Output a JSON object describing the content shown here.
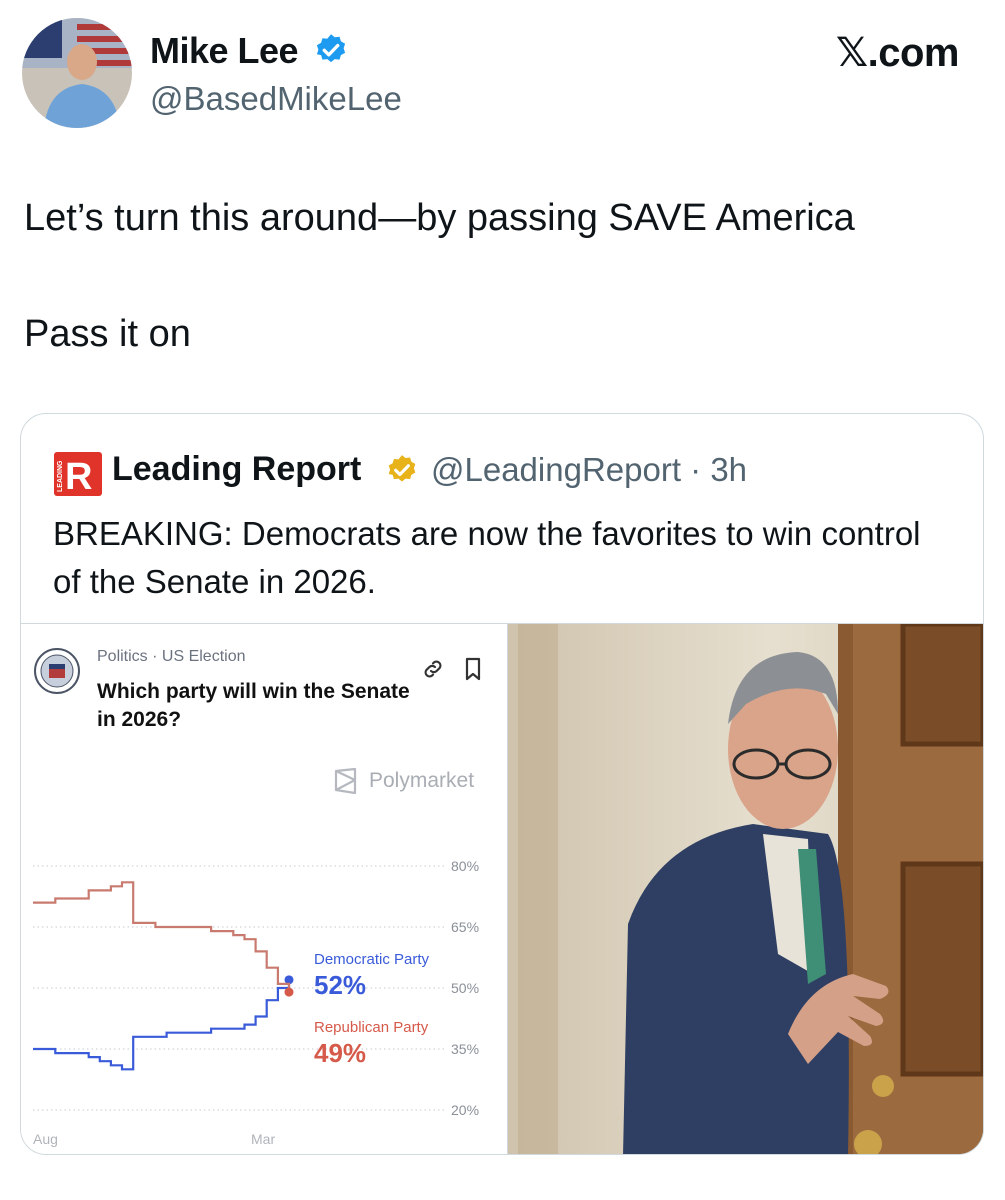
{
  "author": {
    "name": "Mike Lee",
    "handle": "@BasedMikeLee",
    "avatar_icon": "profile-photo"
  },
  "site_logo": "𝕏.com",
  "tweet": {
    "line1": "Let’s turn this around—by passing SAVE America",
    "line2": "Pass it on"
  },
  "quote": {
    "logo_letter": "R",
    "logo_side_text": "LEADING",
    "name": "Leading Report",
    "handle_time": "@LeadingReport · 3h",
    "text": "BREAKING: Democrats are now the favorites to win control of the Senate in 2026."
  },
  "market": {
    "category": "Politics · US Election",
    "question": "Which party will win the Senate in 2026?",
    "brand": "Polymarket"
  },
  "colors": {
    "dem": "#3a5bd9",
    "rep": "#d65a4a",
    "rep_line": "#c97a6e",
    "verified_blue": "#1d9bf0",
    "verified_gold": "#e8b21a",
    "brand_red": "#e0342a"
  },
  "chart_data": {
    "type": "line",
    "x_labels": [
      "Aug",
      "Mar"
    ],
    "y_ticks": [
      "80%",
      "65%",
      "50%",
      "35%",
      "20%"
    ],
    "ylim": [
      20,
      80
    ],
    "series": [
      {
        "name": "Democratic Party",
        "current_label": "52%",
        "color": "#3a5bd9",
        "values": [
          35,
          35,
          34,
          34,
          34,
          33,
          32,
          31,
          30,
          38,
          38,
          38,
          39,
          39,
          39,
          39,
          40,
          40,
          40,
          41,
          43,
          47,
          50,
          52
        ]
      },
      {
        "name": "Republican Party",
        "current_label": "49%",
        "color": "#d65a4a",
        "values": [
          71,
          71,
          72,
          72,
          72,
          74,
          74,
          75,
          76,
          66,
          66,
          65,
          65,
          65,
          65,
          65,
          64,
          64,
          63,
          62,
          59,
          55,
          51,
          49
        ]
      }
    ]
  }
}
